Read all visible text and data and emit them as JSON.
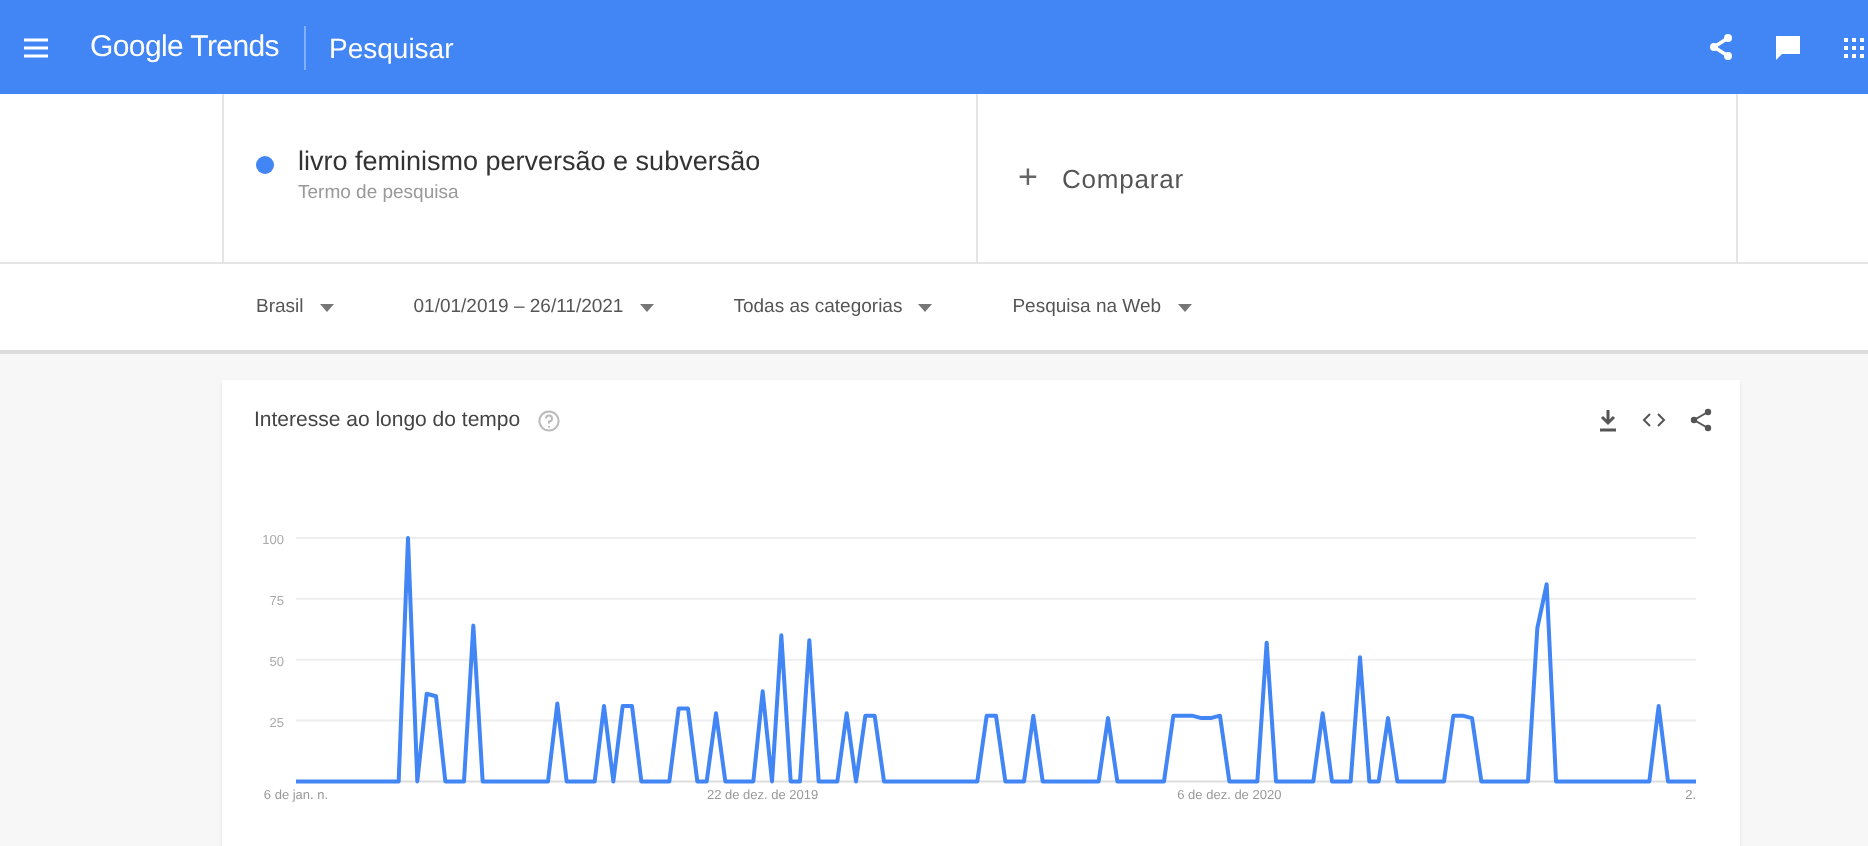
{
  "top_bar": {
    "app_name": "Google Trends",
    "section": "Pesquisar"
  },
  "terms": [
    {
      "label": "livro feminismo perversão e subversão",
      "sublabel": "Termo de pesquisa",
      "color": "#4285f4"
    }
  ],
  "compare": {
    "icon": "+",
    "label": "Comparar"
  },
  "filters": [
    {
      "label": "Brasil"
    },
    {
      "label": "01/01/2019 – 26/11/2021"
    },
    {
      "label": "Todas as categorias"
    },
    {
      "label": "Pesquisa na Web"
    }
  ],
  "interest_card": {
    "title": "Interesse ao longo do tempo",
    "chart_data": {
      "type": "line",
      "grid": true,
      "ylim": [
        0,
        100
      ],
      "categories": [
        "6 de jan. n.",
        null,
        null,
        null,
        null,
        null,
        null,
        null,
        null,
        null,
        null,
        null,
        null,
        null,
        null,
        null,
        null,
        null,
        null,
        null,
        null,
        null,
        null,
        null,
        null,
        null,
        null,
        null,
        null,
        null,
        null,
        null,
        null,
        null,
        null,
        null,
        null,
        null,
        null,
        null,
        null,
        null,
        null,
        null,
        null,
        null,
        null,
        null,
        null,
        null,
        "22 de dez. de 2019",
        null,
        null,
        null,
        null,
        null,
        null,
        null,
        null,
        null,
        null,
        null,
        null,
        null,
        null,
        null,
        null,
        null,
        null,
        null,
        null,
        null,
        null,
        null,
        null,
        null,
        null,
        null,
        null,
        null,
        null,
        null,
        null,
        null,
        null,
        null,
        null,
        null,
        null,
        null,
        null,
        null,
        null,
        null,
        null,
        null,
        null,
        null,
        null,
        null,
        "6 de dez. de 2020",
        null,
        null,
        null,
        null,
        null,
        null,
        null,
        null,
        null,
        null,
        null,
        null,
        null,
        null,
        null,
        null,
        null,
        null,
        null,
        null,
        null,
        null,
        null,
        null,
        null,
        null,
        null,
        null,
        null,
        null,
        null,
        null,
        null,
        null,
        null,
        null,
        null,
        null,
        null,
        null,
        null,
        null,
        null,
        null,
        null,
        null,
        null,
        null,
        null,
        "2."
      ],
      "yticks": [
        25,
        50,
        75,
        100
      ],
      "series": [
        {
          "color": "#4285f4",
          "values": [
            0,
            0,
            0,
            0,
            0,
            0,
            0,
            0,
            0,
            0,
            0,
            0,
            100,
            0,
            36,
            35,
            0,
            0,
            0,
            64,
            0,
            0,
            0,
            0,
            0,
            0,
            0,
            0,
            32,
            0,
            0,
            0,
            0,
            31,
            0,
            31,
            31,
            0,
            0,
            0,
            0,
            30,
            30,
            0,
            0,
            28,
            0,
            0,
            0,
            0,
            37,
            0,
            60,
            0,
            0,
            58,
            0,
            0,
            0,
            28,
            0,
            27,
            27,
            0,
            0,
            0,
            0,
            0,
            0,
            0,
            0,
            0,
            0,
            0,
            27,
            27,
            0,
            0,
            0,
            27,
            0,
            0,
            0,
            0,
            0,
            0,
            0,
            26,
            0,
            0,
            0,
            0,
            0,
            0,
            27,
            27,
            27,
            26,
            26,
            27,
            0,
            0,
            0,
            0,
            57,
            0,
            0,
            0,
            0,
            0,
            28,
            0,
            0,
            0,
            51,
            0,
            0,
            26,
            0,
            0,
            0,
            0,
            0,
            0,
            27,
            27,
            26,
            0,
            0,
            0,
            0,
            0,
            0,
            63,
            81,
            0,
            0,
            0,
            0,
            0,
            0,
            0,
            0,
            0,
            0,
            0,
            31,
            0,
            0,
            0,
            0
          ]
        }
      ]
    }
  }
}
